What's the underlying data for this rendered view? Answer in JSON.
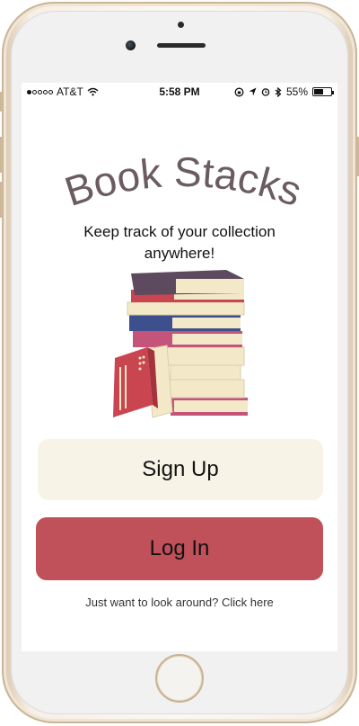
{
  "status_bar": {
    "carrier": "AT&T",
    "time": "5:58 PM",
    "battery_percent": "55%",
    "battery_level": 0.55,
    "icons": [
      "signal-dots-icon",
      "wifi-icon",
      "rotation-lock-icon",
      "location-icon",
      "alarm-icon",
      "bluetooth-icon",
      "battery-icon"
    ]
  },
  "app": {
    "title": "Book Stacks",
    "tagline": "Keep track of your collection anywhere!",
    "illustration": "book-stack-illustration"
  },
  "actions": {
    "signup_label": "Sign Up",
    "login_label": "Log In",
    "browse_label": "Just want to look around? Click here"
  },
  "colors": {
    "title": "#6b5c61",
    "signup_bg": "#f7f3e6",
    "login_bg": "#c0505a",
    "book_cream": "#f3e9c9",
    "book_purple": "#5d4a5e",
    "book_red": "#c94650",
    "book_blue": "#3e4f8e",
    "book_pink": "#c4547a"
  }
}
